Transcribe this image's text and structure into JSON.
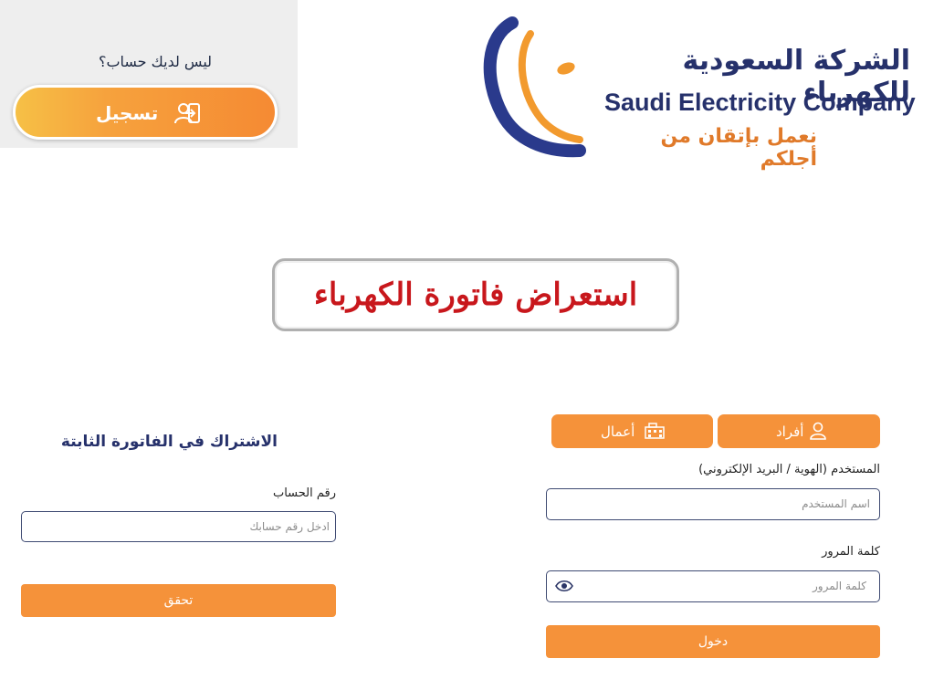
{
  "register": {
    "question": "ليس لديك حساب؟",
    "button_label": "تسجيل",
    "icon": "user-login-icon"
  },
  "logo": {
    "name_ar": "الشركة السعودية للكهرباء",
    "name_en": "Saudi Electricity Company",
    "tagline_ar": "نعمل بإتقان من أجلكم"
  },
  "page_title": "استعراض فاتورة الكهرباء",
  "fixed_bill": {
    "heading": "الاشتراك في الفاتورة الثابتة",
    "account_label": "رقم الحساب",
    "account_placeholder": "ادخل رقم حسابك",
    "verify_button": "تحقق"
  },
  "login": {
    "tab_individuals": "أفراد",
    "tab_business": "أعمال",
    "username_label": "المستخدم (الهوية / البريد الإلكتروني)",
    "username_placeholder": "اسم المستخدم",
    "password_label": "كلمة المرور",
    "password_placeholder": "كلمة المرور",
    "login_button": "دخول"
  },
  "colors": {
    "accent_orange": "#f5923a",
    "brand_navy": "#26316b",
    "title_red": "#c8171c"
  }
}
